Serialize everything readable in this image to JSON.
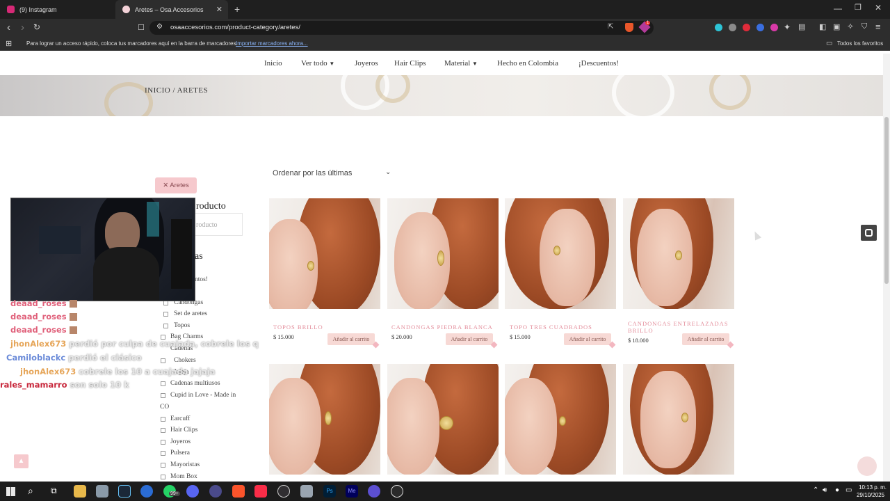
{
  "browser": {
    "tabs": [
      {
        "title": "(9) Instagram",
        "color": "#d62976"
      },
      {
        "title": "Aretes – Osa Accesorios",
        "color": "#f4b6c2"
      }
    ],
    "new_tab": "+",
    "url": "osaaccesorios.com/product-category/aretes/",
    "bookmarks_text": "Para lograr un acceso rápido, coloca tus marcadores aquí en la barra de marcadores.",
    "bookmarks_link": "Importar marcadores ahora...",
    "all_favorites": "Todos los favoritos",
    "ext_badge": "1"
  },
  "nav": {
    "items": [
      "Inicio",
      "Ver todo",
      "Joyeros",
      "Hair Clips",
      "Material",
      "Hecho en Colombia",
      "¡Descuentos!"
    ]
  },
  "breadcrumb": "INICIO / ARETES",
  "sidebar": {
    "filter_chip": "✕ Aretes",
    "search_heading": "roducto",
    "search_placeholder": "roducto",
    "categories_heading": "as",
    "discounts_item": "ntos!",
    "categories": [
      "Candongas",
      "Set de aretes",
      "Topos",
      "Bag Charms",
      "Cadenas",
      "Chokers",
      "Cadenas multiusos",
      "Cupid in Love - Made in",
      "CO",
      "Earcuff",
      "Hair Clips",
      "Joyeros",
      "Pulsera",
      "Mayoristas",
      "Mom Box"
    ],
    "partial_item": "Jajaja"
  },
  "sort": {
    "label": "Ordenar por las últimas"
  },
  "products": [
    {
      "title": "TOPOS BRILLO",
      "price": "$ 15.000",
      "cart": "Añadir al carrito"
    },
    {
      "title": "CANDONGAS PIEDRA BLANCA",
      "price": "$ 20.000",
      "cart": "Añadir al carrito"
    },
    {
      "title": "TOPO TRES CUADRADOS",
      "price": "$ 15.000",
      "cart": "Añadir al carrito"
    },
    {
      "title": "CANDONGAS ENTRELAZADAS",
      "title2": "BRILLO",
      "price": "$ 18.000",
      "cart": "Añadir al carrito"
    }
  ],
  "chat": [
    {
      "user": "deaad_roses",
      "msg": "",
      "color": "#e0607a"
    },
    {
      "user": "deaad_roses",
      "msg": "",
      "color": "#e0607a"
    },
    {
      "user": "deaad_roses",
      "msg": "",
      "color": "#e0607a"
    },
    {
      "user": "jhonAlex673",
      "msg": "perdió por culpa de cuajada, cobrele los q",
      "color": "#e6a65a"
    },
    {
      "user": "Camiloblackc",
      "msg": "perdió el clásico",
      "color": "#6a8ad8"
    },
    {
      "user": "jhonAlex673",
      "msg": "cobrele los 10 a cuajada jajaja",
      "color": "#e6a65a"
    },
    {
      "user": "rales_mamarro",
      "msg": "son solo 10 k",
      "color": "#c8283c"
    }
  ],
  "taskbar": {
    "time": "10:13 p. m.",
    "date": "29/10/2025",
    "badge": "99+"
  }
}
